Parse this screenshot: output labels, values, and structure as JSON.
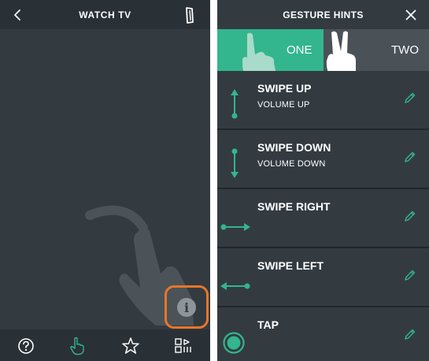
{
  "left_screen": {
    "header": {
      "title": "WATCH TV"
    },
    "info_button": {
      "glyph": "i"
    },
    "bottom_nav": {
      "items": [
        {
          "name": "help",
          "icon": "question-circle-icon"
        },
        {
          "name": "gesture",
          "icon": "hand-tap-icon",
          "active": true
        },
        {
          "name": "favorites",
          "icon": "star-icon"
        },
        {
          "name": "channels",
          "icon": "channel-list-icon"
        }
      ]
    },
    "highlight_color": "#e8762a"
  },
  "right_screen": {
    "header": {
      "title": "GESTURE HINTS"
    },
    "tabs": [
      {
        "label": "ONE",
        "active": true
      },
      {
        "label": "TWO",
        "active": false
      }
    ],
    "gestures": [
      {
        "title": "SWIPE UP",
        "description": "VOLUME UP",
        "icon": "arrow-up-icon"
      },
      {
        "title": "SWIPE DOWN",
        "description": "VOLUME DOWN",
        "icon": "arrow-down-icon"
      },
      {
        "title": "SWIPE RIGHT",
        "description": "",
        "icon": "arrow-right-icon"
      },
      {
        "title": "SWIPE LEFT",
        "description": "",
        "icon": "arrow-left-icon"
      },
      {
        "title": "TAP",
        "description": "",
        "icon": "tap-circle-icon"
      }
    ]
  },
  "colors": {
    "accent": "#33b58d",
    "background": "#333b41",
    "bar": "#2a3136",
    "highlight": "#e8762a"
  }
}
